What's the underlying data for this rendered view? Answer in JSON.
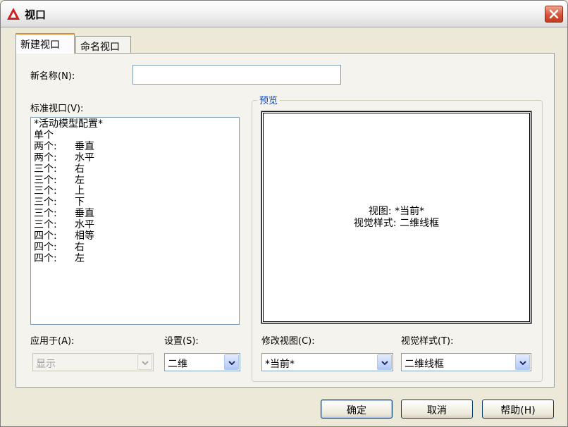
{
  "window": {
    "title": "视口",
    "close_icon": "close-icon"
  },
  "tabs": [
    {
      "label": "新建视口"
    },
    {
      "label": "命名视口"
    }
  ],
  "new_name": {
    "label": "新名称(N):",
    "value": ""
  },
  "standard_viewports": {
    "label": "标准视口(V):",
    "items": [
      {
        "a": "*活动模型配置*",
        "b": ""
      },
      {
        "a": "单个",
        "b": ""
      },
      {
        "a": "两个:",
        "b": "垂直"
      },
      {
        "a": "两个:",
        "b": "水平"
      },
      {
        "a": "三个:",
        "b": "右"
      },
      {
        "a": "三个:",
        "b": "左"
      },
      {
        "a": "三个:",
        "b": "上"
      },
      {
        "a": "三个:",
        "b": "下"
      },
      {
        "a": "三个:",
        "b": "垂直"
      },
      {
        "a": "三个:",
        "b": "水平"
      },
      {
        "a": "四个:",
        "b": "相等"
      },
      {
        "a": "四个:",
        "b": "右"
      },
      {
        "a": "四个:",
        "b": "左"
      }
    ]
  },
  "preview": {
    "title": "预览",
    "line1": "视图: *当前*",
    "line2": "视觉样式: 二维线框"
  },
  "apply_to": {
    "label": "应用于(A):",
    "value": "显示"
  },
  "setup": {
    "label": "设置(S):",
    "value": "二维"
  },
  "change_view": {
    "label": "修改视图(C):",
    "value": "*当前*"
  },
  "visual_style": {
    "label": "视觉样式(T):",
    "value": "二维线框"
  },
  "buttons": {
    "ok": "确定",
    "cancel": "取消",
    "help": "帮助(H)"
  },
  "colors": {
    "accent": "#e68b2c",
    "group_title": "#0046d5",
    "close": "#d8533a"
  }
}
